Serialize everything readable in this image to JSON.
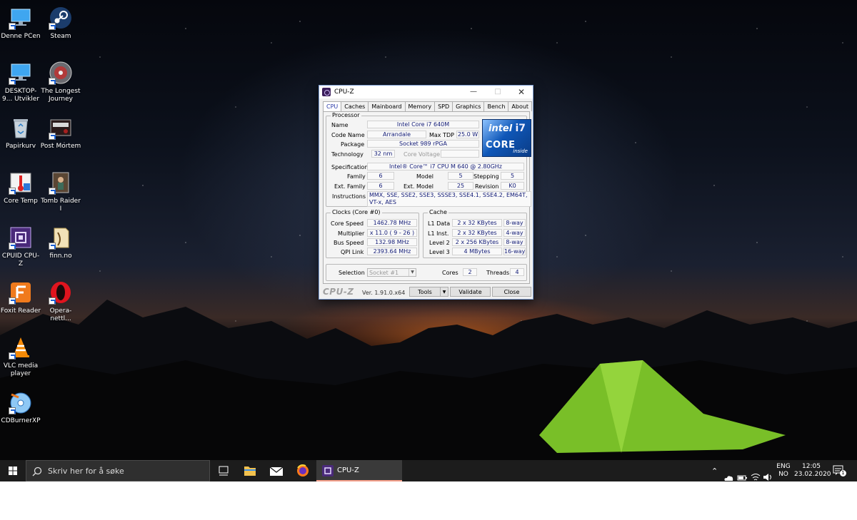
{
  "desktop": {
    "icons": [
      {
        "label": "Denne PCen",
        "icon": "computer-icon"
      },
      {
        "label": "Steam",
        "icon": "steam-icon"
      },
      {
        "label": "DESKTOP-9... Utvikler",
        "icon": "network-computer-icon"
      },
      {
        "label": "The Longest Journey",
        "icon": "game-disc-icon"
      },
      {
        "label": "Papirkurv",
        "icon": "recycle-bin-icon"
      },
      {
        "label": "Post Mortem",
        "icon": "game-icon"
      },
      {
        "label": "Core Temp",
        "icon": "thermometer-icon"
      },
      {
        "label": "Tomb Raider I",
        "icon": "game-icon"
      },
      {
        "label": "CPUID CPU-Z",
        "icon": "cpuz-icon"
      },
      {
        "label": "finn.no",
        "icon": "folder-icon"
      },
      {
        "label": "Foxit Reader",
        "icon": "pdf-icon"
      },
      {
        "label": "Opera-nettl...",
        "icon": "opera-icon"
      },
      {
        "label": "VLC media player",
        "icon": "vlc-cone-icon"
      },
      {
        "label": "CDBurnerXP",
        "icon": "disc-icon"
      }
    ]
  },
  "cpuz": {
    "title": "CPU-Z",
    "tabs": [
      "CPU",
      "Caches",
      "Mainboard",
      "Memory",
      "SPD",
      "Graphics",
      "Bench",
      "About"
    ],
    "processor": {
      "group_label": "Processor",
      "name_label": "Name",
      "name": "Intel Core i7 640M",
      "codename_label": "Code Name",
      "codename": "Arrandale",
      "maxtdp_label": "Max TDP",
      "maxtdp": "25.0 W",
      "package_label": "Package",
      "package": "Socket 989 rPGA",
      "technology_label": "Technology",
      "technology": "32 nm",
      "corevoltage_label": "Core Voltage",
      "corevoltage": "",
      "specification_label": "Specification",
      "specification": "Intel® Core™ i7 CPU     M 640  @ 2.80GHz",
      "family_label": "Family",
      "family": "6",
      "model_label": "Model",
      "model": "5",
      "stepping_label": "Stepping",
      "stepping": "5",
      "extfamily_label": "Ext. Family",
      "extfamily": "6",
      "extmodel_label": "Ext. Model",
      "extmodel": "25",
      "revision_label": "Revision",
      "revision": "K0",
      "instructions_label": "Instructions",
      "instructions": "MMX, SSE, SSE2, SSE3, SSSE3, SSE4.1, SSE4.2, EM64T, VT-x, AES",
      "logo": {
        "brand": "intel",
        "line": "CORE",
        "tier": "i7",
        "tagline": "inside"
      }
    },
    "clocks": {
      "group_label": "Clocks (Core #0)",
      "corespeed_label": "Core Speed",
      "corespeed": "1462.78 MHz",
      "multiplier_label": "Multiplier",
      "multiplier": "x 11.0 ( 9 - 26 )",
      "busspeed_label": "Bus Speed",
      "busspeed": "132.98 MHz",
      "qpilink_label": "QPI Link",
      "qpilink": "2393.64 MHz"
    },
    "cache": {
      "group_label": "Cache",
      "rows": [
        {
          "label": "L1 Data",
          "size": "2 x 32 KBytes",
          "way": "8-way"
        },
        {
          "label": "L1 Inst.",
          "size": "2 x 32 KBytes",
          "way": "4-way"
        },
        {
          "label": "Level 2",
          "size": "2 x 256 KBytes",
          "way": "8-way"
        },
        {
          "label": "Level 3",
          "size": "4 MBytes",
          "way": "16-way"
        }
      ]
    },
    "selection": {
      "selection_label": "Selection",
      "selection": "Socket #1",
      "cores_label": "Cores",
      "cores": "2",
      "threads_label": "Threads",
      "threads": "4"
    },
    "footer": {
      "logo": "CPU-Z",
      "version": "Ver. 1.91.0.x64",
      "tools": "Tools",
      "validate": "Validate",
      "close": "Close"
    }
  },
  "taskbar": {
    "search_placeholder": "Skriv her for å søke",
    "active_app": "CPU-Z",
    "language": "ENG",
    "layout": "NO",
    "time": "12:05",
    "date": "23.02.2020",
    "notification_count": "1"
  }
}
